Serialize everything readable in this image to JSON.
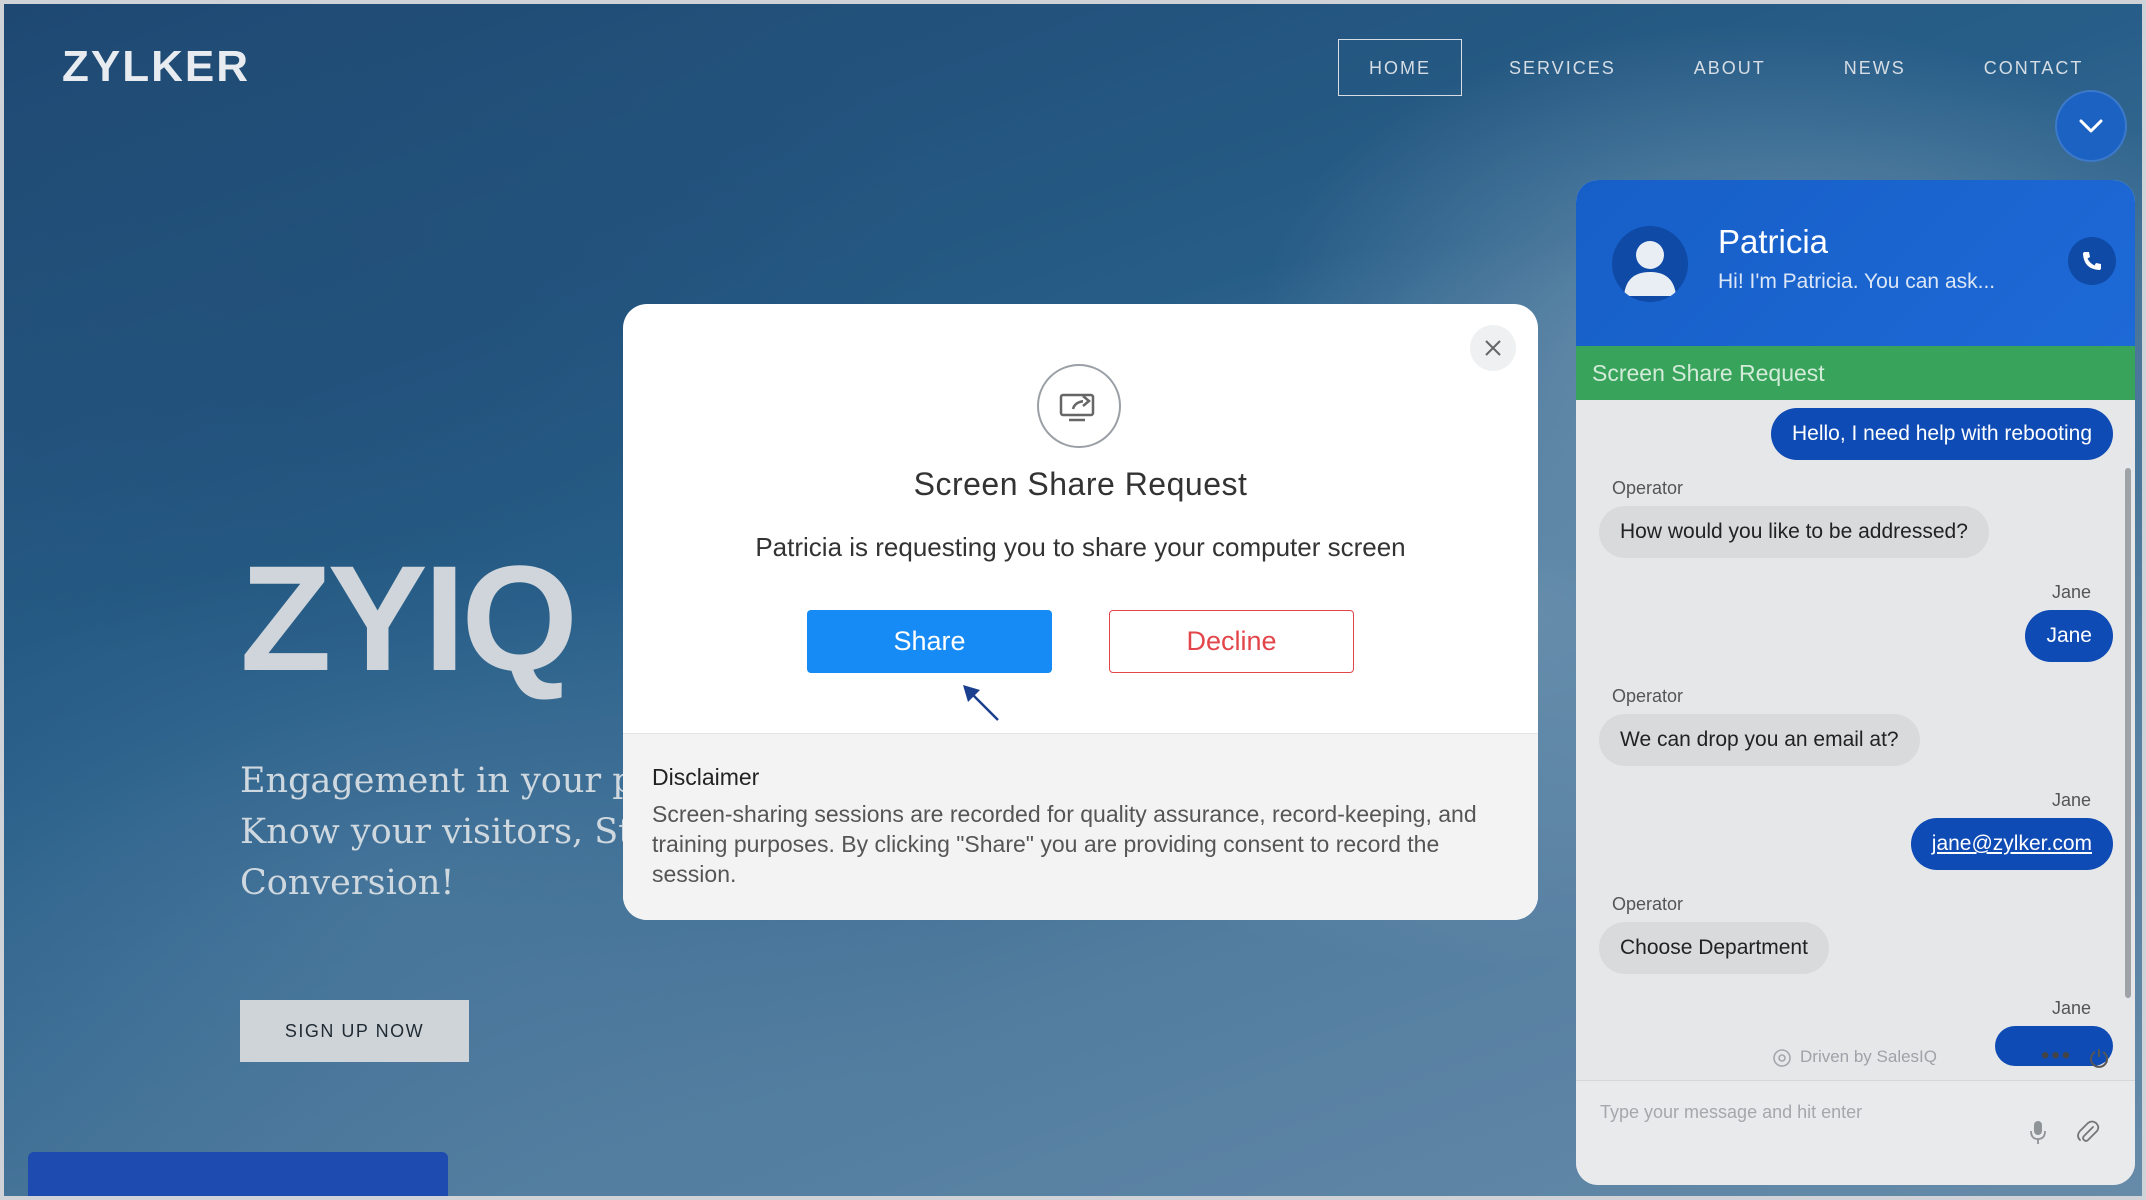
{
  "site": {
    "logo": "ZYLKER",
    "nav": [
      "HOME",
      "SERVICES",
      "ABOUT",
      "NEWS",
      "CONTACT"
    ],
    "active_nav": "HOME"
  },
  "hero": {
    "title": "ZYIQ",
    "line1": "Engagement in your palms",
    "line2": "Know your visitors, Start t",
    "line3": "Conversion!",
    "cta": "SIGN UP NOW"
  },
  "modal": {
    "title": "Screen Share Request",
    "message": "Patricia is requesting you to share your computer screen",
    "share_label": "Share",
    "decline_label": "Decline",
    "disclaimer_title": "Disclaimer",
    "disclaimer_body": "Screen-sharing sessions are recorded for quality assurance, record-keeping, and training purposes. By clicking \"Share\" you are providing consent to record the session."
  },
  "chat": {
    "agent_name": "Patricia",
    "agent_status": "Hi! I'm Patricia. You can ask...",
    "banner": "Screen Share Request",
    "messages": {
      "m1": "Hello, I need help with rebooting",
      "op_label": "Operator",
      "me_label": "Jane",
      "m2": "How would you like to be addressed?",
      "m3": "Jane",
      "m4": "We can drop you an email at?",
      "m5": "jane@zylker.com",
      "m6": "Choose Department"
    },
    "powered_by": "Driven by SalesIQ",
    "input_placeholder": "Type your message and hit enter"
  },
  "colors": {
    "chat_blue": "#1b62c2",
    "share_blue": "#168bf5",
    "decline_red": "#e2464b",
    "banner_green": "#38a35a"
  },
  "icons": [
    "chevron-down-icon",
    "close-icon",
    "screen-share-icon",
    "cursor-icon",
    "user-avatar-icon",
    "phone-icon",
    "salesiq-icon",
    "more-icon",
    "power-icon",
    "mic-icon",
    "paperclip-icon"
  ]
}
